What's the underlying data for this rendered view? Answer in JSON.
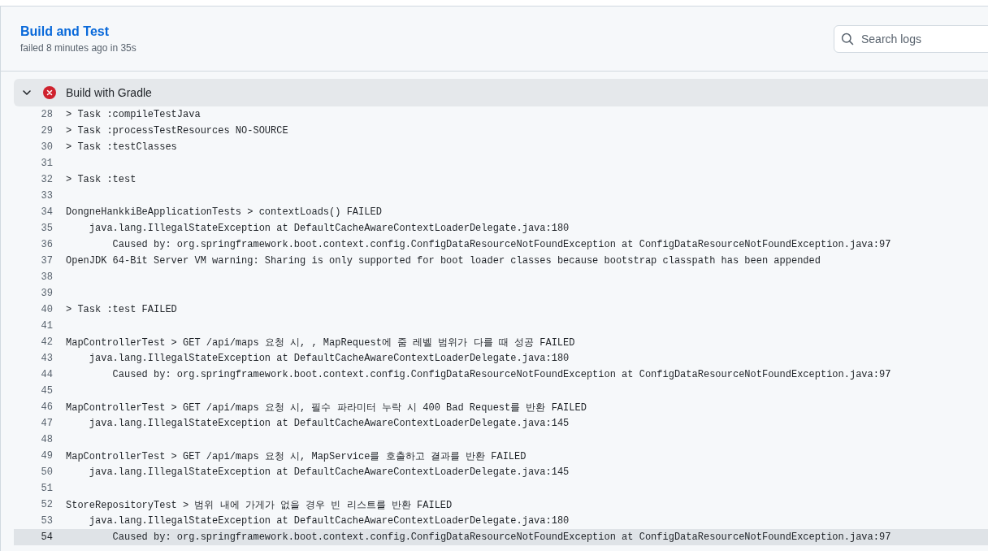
{
  "job": {
    "title": "Build and Test",
    "status_line": "failed 8 minutes ago in 35s"
  },
  "search": {
    "placeholder": "Search logs"
  },
  "step": {
    "name": "Build with Gradle",
    "expanded": true,
    "failed": true
  },
  "log_lines": [
    {
      "number": "28",
      "text": "> Task :compileTestJava",
      "selected": false
    },
    {
      "number": "29",
      "text": "> Task :processTestResources NO-SOURCE",
      "selected": false
    },
    {
      "number": "30",
      "text": "> Task :testClasses",
      "selected": false
    },
    {
      "number": "31",
      "selected": false
    },
    {
      "number": "32",
      "text": "> Task :test",
      "selected": false
    },
    {
      "number": "33",
      "selected": false
    },
    {
      "number": "34",
      "text": "DongneHankkiBeApplicationTests > contextLoads() FAILED",
      "selected": false
    },
    {
      "number": "35",
      "text": "    java.lang.IllegalStateException at DefaultCacheAwareContextLoaderDelegate.java:180",
      "selected": false
    },
    {
      "number": "36",
      "text": "        Caused by: org.springframework.boot.context.config.ConfigDataResourceNotFoundException at ConfigDataResourceNotFoundException.java:97",
      "selected": false
    },
    {
      "number": "37",
      "text": "OpenJDK 64-Bit Server VM warning: Sharing is only supported for boot loader classes because bootstrap classpath has been appended",
      "selected": false
    },
    {
      "number": "38",
      "selected": false
    },
    {
      "number": "39",
      "selected": false
    },
    {
      "number": "40",
      "text": "> Task :test FAILED",
      "selected": false
    },
    {
      "number": "41",
      "selected": false
    },
    {
      "number": "42",
      "text": "MapControllerTest > GET /api/maps 요청 시, , MapRequest에 줌 레벨 범위가 다를 때 성공 FAILED",
      "selected": false
    },
    {
      "number": "43",
      "text": "    java.lang.IllegalStateException at DefaultCacheAwareContextLoaderDelegate.java:180",
      "selected": false
    },
    {
      "number": "44",
      "text": "        Caused by: org.springframework.boot.context.config.ConfigDataResourceNotFoundException at ConfigDataResourceNotFoundException.java:97",
      "selected": false
    },
    {
      "number": "45",
      "selected": false
    },
    {
      "number": "46",
      "text": "MapControllerTest > GET /api/maps 요청 시, 필수 파라미터 누락 시 400 Bad Request를 반환 FAILED",
      "selected": false
    },
    {
      "number": "47",
      "text": "    java.lang.IllegalStateException at DefaultCacheAwareContextLoaderDelegate.java:145",
      "selected": false
    },
    {
      "number": "48",
      "selected": false
    },
    {
      "number": "49",
      "text": "MapControllerTest > GET /api/maps 요청 시, MapService를 호출하고 결과를 반환 FAILED",
      "selected": false
    },
    {
      "number": "50",
      "text": "    java.lang.IllegalStateException at DefaultCacheAwareContextLoaderDelegate.java:145",
      "selected": false
    },
    {
      "number": "51",
      "selected": false
    },
    {
      "number": "52",
      "text": "StoreRepositoryTest > 범위 내에 가게가 없을 경우 빈 리스트를 반환 FAILED",
      "selected": false
    },
    {
      "number": "53",
      "text": "    java.lang.IllegalStateException at DefaultCacheAwareContextLoaderDelegate.java:180",
      "selected": false
    },
    {
      "number": "54",
      "text": "        Caused by: org.springframework.boot.context.config.ConfigDataResourceNotFoundException at ConfigDataResourceNotFoundException.java:97",
      "selected": true
    }
  ]
}
